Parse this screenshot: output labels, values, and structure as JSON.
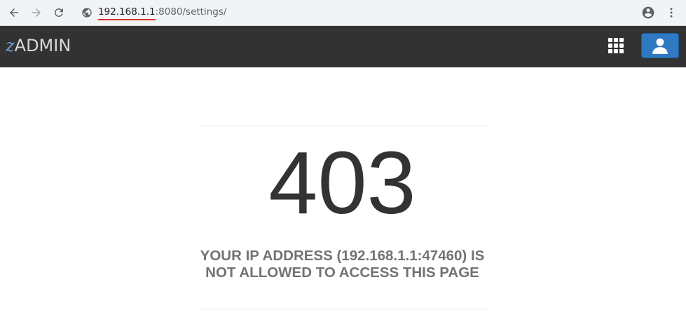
{
  "browser": {
    "url_host": "192.168.1.1",
    "url_rest": ":8080/settings/"
  },
  "header": {
    "logo_mark": "z",
    "logo_text": "ADMIN"
  },
  "error": {
    "code": "403",
    "message": "YOUR IP ADDRESS (192.168.1.1:47460) IS NOT ALLOWED TO ACCESS THIS PAGE"
  },
  "icons": {
    "back": "arrow-left-icon",
    "forward": "arrow-right-icon",
    "reload": "reload-icon",
    "site_info": "globe-icon",
    "profile": "account-circle-icon",
    "menu": "more-vert-icon",
    "apps": "apps-grid-icon",
    "user": "user-icon"
  },
  "colors": {
    "header_bg": "#323232",
    "user_button": "#2f79c2",
    "url_underline": "#d93025",
    "error_code": "#333333",
    "error_message": "#737373"
  }
}
